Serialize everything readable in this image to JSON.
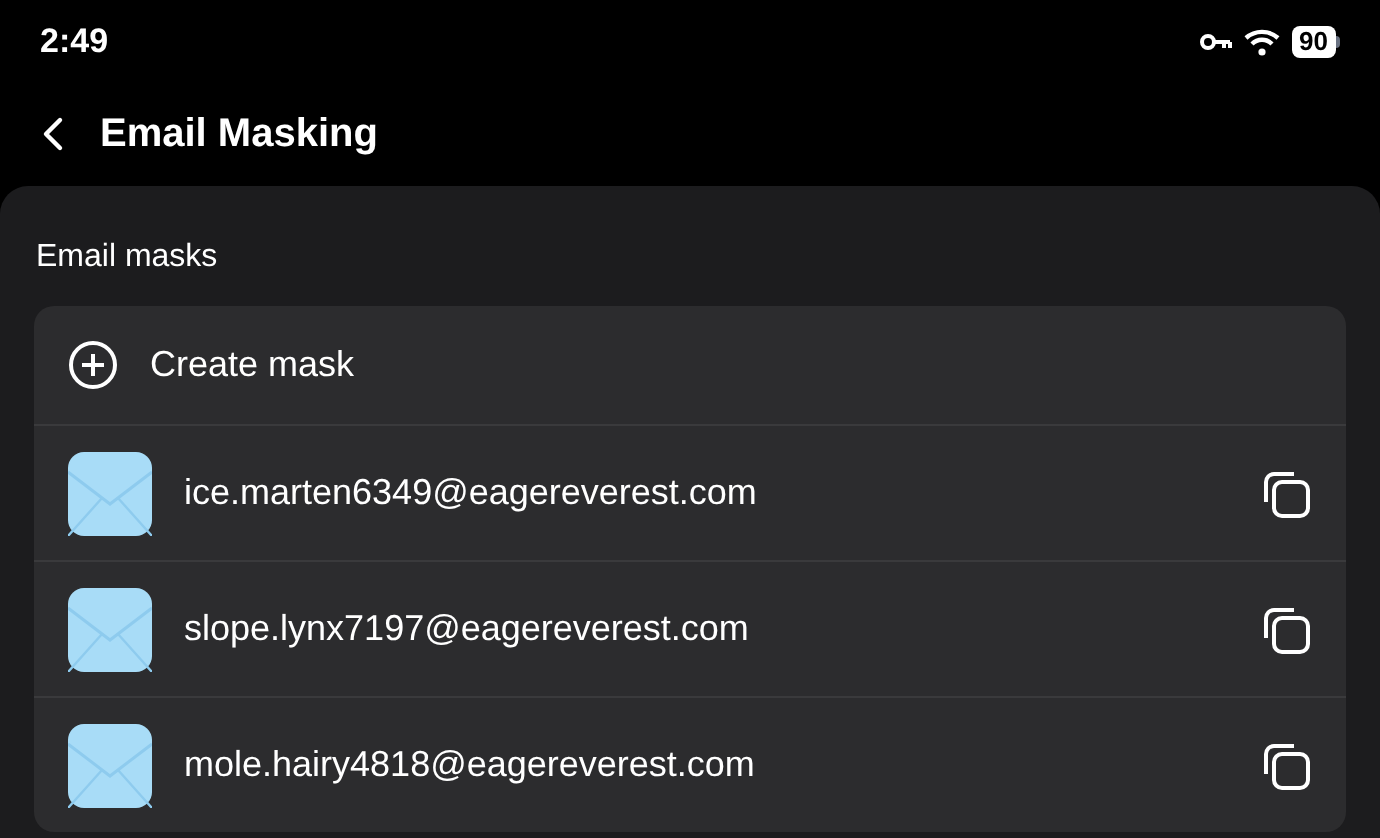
{
  "status_bar": {
    "time": "2:49",
    "battery": "90"
  },
  "header": {
    "title": "Email Masking"
  },
  "section": {
    "title": "Email masks",
    "create_label": "Create mask",
    "masks": [
      {
        "address": "ice.marten6349@eagereverest.com"
      },
      {
        "address": "slope.lynx7197@eagereverest.com"
      },
      {
        "address": "mole.hairy4818@eagereverest.com"
      }
    ]
  }
}
